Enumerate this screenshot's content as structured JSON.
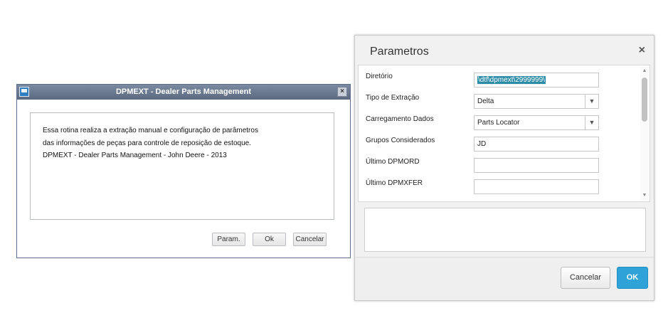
{
  "legacy_dialog": {
    "title": "DPMEXT - Dealer Parts Management",
    "close_glyph": "×",
    "icons": [
      "app-window-icon"
    ],
    "lines": [
      "Essa rotina realiza a extração manual e configuração de parâmetros",
      "das informações de peças para controle de reposição de estoque.",
      "DPMEXT - Dealer Parts Management - John Deere - 2013"
    ],
    "buttons": {
      "param": "Param.",
      "ok": "Ok",
      "cancel": "Cancelar"
    }
  },
  "parametros_dialog": {
    "title": "Parametros",
    "close_glyph": "×",
    "fields": {
      "diretorio": {
        "label": "Diretório",
        "value": "\\dtf\\dpmext\\2999999\\"
      },
      "tipo_extracao": {
        "label": "Tipo de Extração",
        "value": "Delta"
      },
      "carregamento": {
        "label": "Carregamento Dados",
        "value": "Parts Locator"
      },
      "grupos": {
        "label": "Grupos Considerados",
        "value": "JD"
      },
      "ultimo_dpmord": {
        "label": "Último DPMORD",
        "value": ""
      },
      "ultimo_dpmxfer": {
        "label": "Último DPMXFER",
        "value": ""
      }
    },
    "dropdown_glyph": "▼",
    "scroll_up_glyph": "▲",
    "scroll_down_glyph": "▼",
    "buttons": {
      "cancel": "Cancelar",
      "ok": "OK"
    },
    "colors": {
      "ok_button": "#2fa3d7",
      "selection": "#2c8ca8"
    }
  }
}
